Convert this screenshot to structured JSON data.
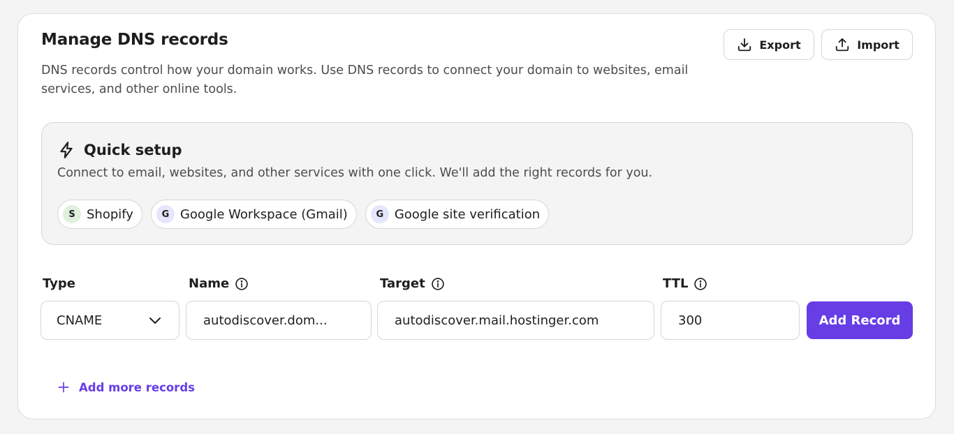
{
  "header": {
    "title": "Manage DNS records",
    "description": "DNS records control how your domain works. Use DNS records to connect your domain to websites, email services, and other online tools.",
    "export_label": "Export",
    "import_label": "Import"
  },
  "quick_setup": {
    "icon": "lightning-icon",
    "title": "Quick setup",
    "description": "Connect to email, websites, and other services with one click. We'll add the right records for you.",
    "chips": [
      {
        "badge": "S",
        "label": "Shopify"
      },
      {
        "badge": "G",
        "label": "Google Workspace (Gmail)"
      },
      {
        "badge": "G",
        "label": "Google site verification"
      }
    ]
  },
  "form": {
    "type_label": "Type",
    "type_value": "CNAME",
    "name_label": "Name",
    "name_value": "autodiscover.dom...",
    "target_label": "Target",
    "target_value": "autodiscover.mail.hostinger.com",
    "ttl_label": "TTL",
    "ttl_value": "300",
    "add_record_label": "Add Record",
    "add_more_label": "Add more records"
  },
  "colors": {
    "accent": "#673de6",
    "text": "#1d1e20",
    "muted": "#4b4c50",
    "border": "#d6d6d9"
  }
}
